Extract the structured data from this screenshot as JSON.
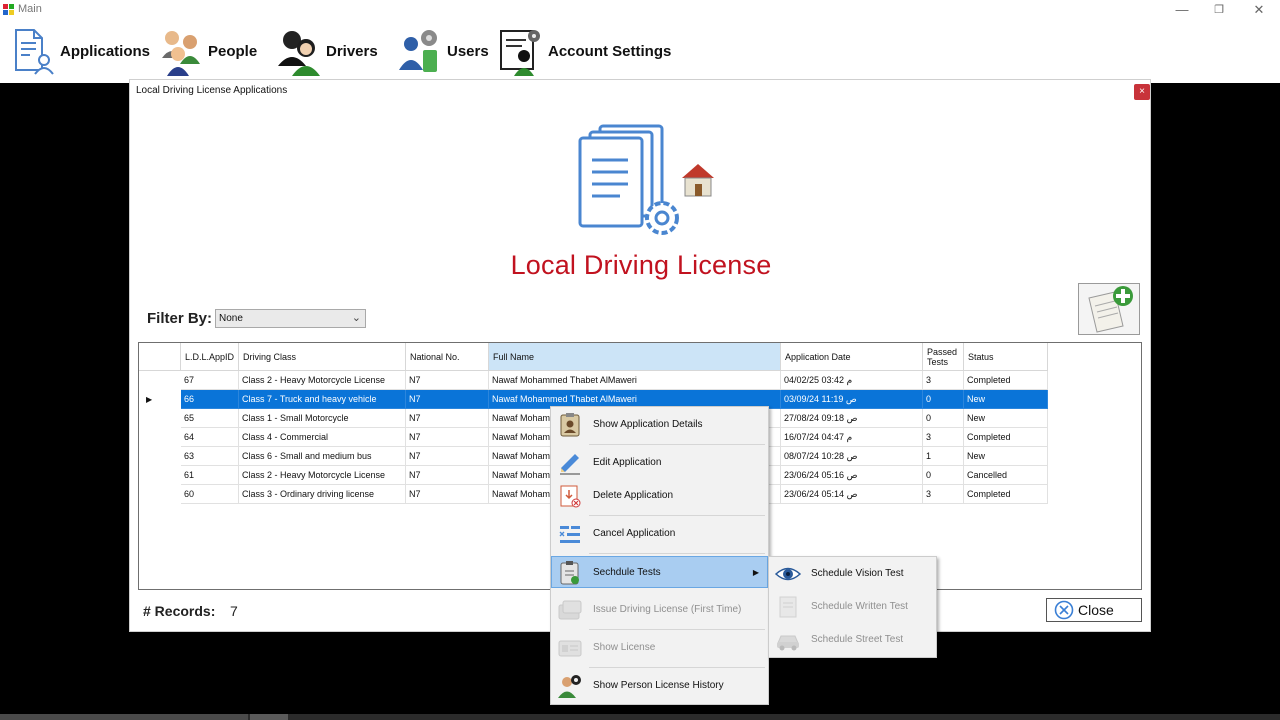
{
  "main_window": {
    "title": "Main",
    "controls": {
      "minimize": "—",
      "restore": "❐",
      "close": "✕"
    }
  },
  "menubar": {
    "items": [
      {
        "label": "Applications",
        "icon": "document-user-icon"
      },
      {
        "label": "People",
        "icon": "people-icon"
      },
      {
        "label": "Drivers",
        "icon": "drivers-icon"
      },
      {
        "label": "Users",
        "icon": "users-gear-icon"
      },
      {
        "label": "Account Settings",
        "icon": "account-settings-icon"
      }
    ]
  },
  "child_window": {
    "title": "Local Driving License Applications",
    "close": "×",
    "heading": "Local Driving License",
    "filter": {
      "label": "Filter By:",
      "value": "None",
      "chevron": "⌵"
    },
    "add_button_icon": "add-application-icon",
    "grid": {
      "columns": [
        "L.D.L.AppID",
        "Driving Class",
        "National No.",
        "Full Name",
        "Application Date",
        "Passed Tests",
        "Status"
      ],
      "rows": [
        [
          "67",
          "Class 2 - Heavy Motorcycle License",
          "N7",
          "Nawaf Mohammed Thabet AlMaweri",
          "04/02/25 03:42 م",
          "3",
          "Completed"
        ],
        [
          "66",
          "Class 7 - Truck and heavy vehicle",
          "N7",
          "Nawaf Mohammed Thabet AlMaweri",
          "03/09/24 11:19 ص",
          "0",
          "New"
        ],
        [
          "65",
          "Class 1 - Small Motorcycle",
          "N7",
          "Nawaf Mohamm",
          "27/08/24 09:18 ص",
          "0",
          "New"
        ],
        [
          "64",
          "Class 4 - Commercial",
          "N7",
          "Nawaf Mohamm",
          "16/07/24 04:47 م",
          "3",
          "Completed"
        ],
        [
          "63",
          "Class 6 - Small and medium bus",
          "N7",
          "Nawaf Mohamm",
          "08/07/24 10:28 ص",
          "1",
          "New"
        ],
        [
          "61",
          "Class 2 - Heavy Motorcycle License",
          "N7",
          "Nawaf Mohamm",
          "23/06/24 05:16 ص",
          "0",
          "Cancelled"
        ],
        [
          "60",
          "Class 3 - Ordinary driving license",
          "N7",
          "Nawaf Mohamm",
          "23/06/24 05:14 ص",
          "3",
          "Completed"
        ]
      ],
      "selected_row_marker": "▶"
    },
    "records": {
      "label": "# Records:",
      "count": "7"
    },
    "close_button": "Close"
  },
  "context_menu": {
    "items": [
      {
        "label": "Show Application Details",
        "icon": "clipboard-person-icon",
        "enabled": true
      },
      {
        "label": "Edit Application",
        "icon": "edit-pen-icon",
        "enabled": true
      },
      {
        "label": "Delete Application",
        "icon": "delete-document-icon",
        "enabled": true
      },
      {
        "label": "Cancel Application",
        "icon": "cancel-list-icon",
        "enabled": true
      },
      {
        "label": "Sechdule Tests",
        "icon": "schedule-tests-icon",
        "enabled": true,
        "submenu_arrow": "▶"
      },
      {
        "label": "Issue Driving License (First Time)",
        "icon": "issue-license-icon",
        "enabled": false
      },
      {
        "label": "Show License",
        "icon": "license-card-icon",
        "enabled": false
      },
      {
        "label": "Show Person License History",
        "icon": "person-history-icon",
        "enabled": true
      }
    ]
  },
  "submenu": {
    "items": [
      {
        "label": "Schedule Vision Test",
        "icon": "eye-icon",
        "enabled": true
      },
      {
        "label": "Schedule Written Test",
        "icon": "written-test-icon",
        "enabled": false
      },
      {
        "label": "Schedule Street Test",
        "icon": "car-icon",
        "enabled": false
      }
    ]
  },
  "colors": {
    "title_red": "#c1121f",
    "selection_blue": "#0a74d8",
    "menu_highlight": "#a9cdf1"
  }
}
